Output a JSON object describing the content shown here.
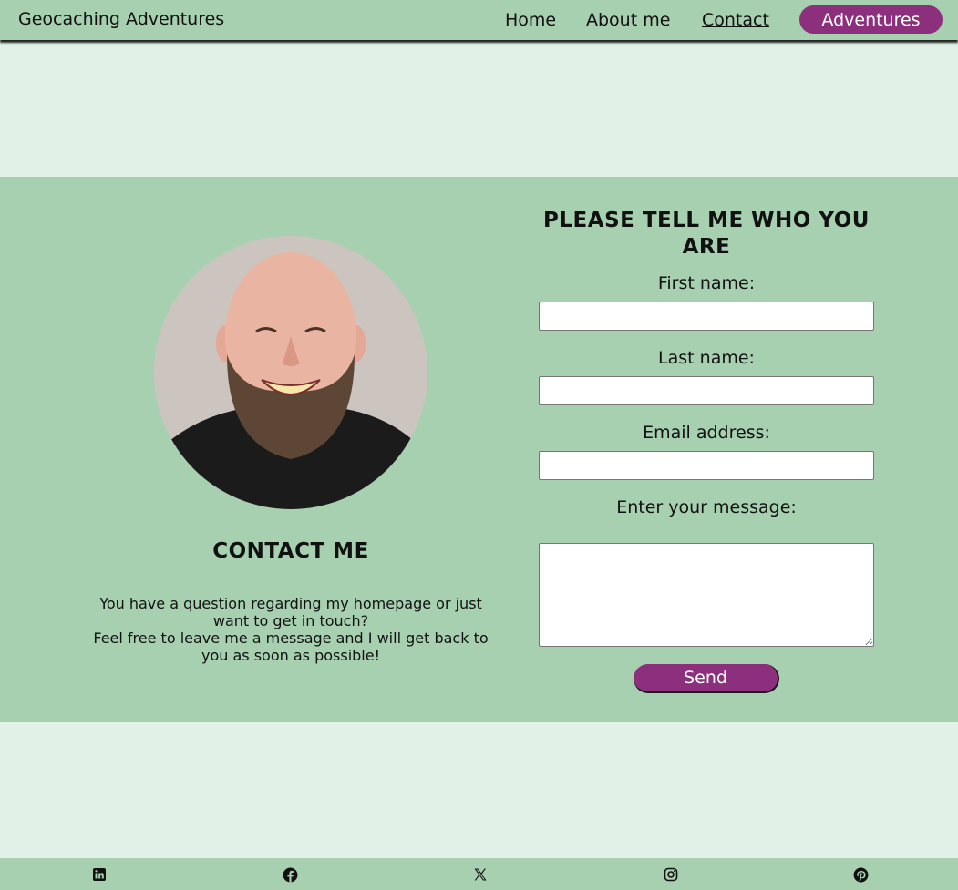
{
  "header": {
    "brand": "Geocaching Adventures",
    "nav": {
      "home": "Home",
      "about": "About me",
      "contact": "Contact",
      "adventures": "Adventures"
    }
  },
  "contact": {
    "title": "CONTACT ME",
    "text_line1": "You have a question regarding my homepage or just want to get in touch?",
    "text_line2": "Feel free to leave me a message and I will get back to you as soon as possible!"
  },
  "form": {
    "title": "PLEASE TELL ME WHO YOU ARE",
    "first_name_label": "First name:",
    "first_name_value": "",
    "last_name_label": "Last name:",
    "last_name_value": "",
    "email_label": "Email address:",
    "email_value": "",
    "message_label": "Enter your message:",
    "message_value": "",
    "send_label": "Send"
  },
  "footer": {
    "icons": [
      "linkedin-icon",
      "facebook-icon",
      "x-icon",
      "instagram-icon",
      "pinterest-icon"
    ]
  },
  "colors": {
    "accent": "#8c2f7c",
    "band": "#a7d0b1",
    "background": "#e1f1e7"
  }
}
